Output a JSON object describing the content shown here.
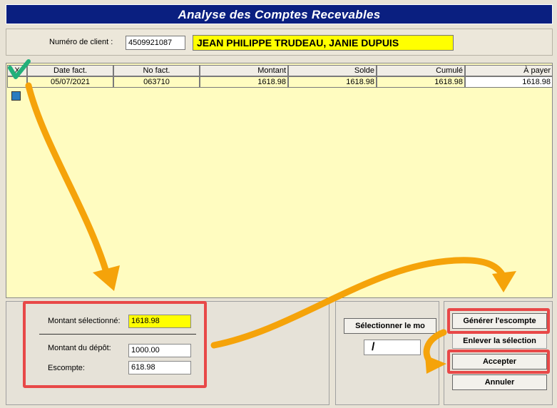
{
  "window": {
    "title": "Analyse des Comptes Recevables"
  },
  "client": {
    "label": "Numéro de client :",
    "number": "4509921087",
    "name": "JEAN PHILIPPE TRUDEAU, JANIE DUPUIS"
  },
  "grid": {
    "columns": [
      "X",
      "Date fact.",
      "No fact.",
      "Montant",
      "Solde",
      "Cumulé",
      "À payer"
    ],
    "rows": [
      {
        "checked": true,
        "date": "05/07/2021",
        "invoice": "063710",
        "montant": "1618.98",
        "solde": "1618.98",
        "cumule": "1618.98",
        "a_payer": "1618.98"
      }
    ]
  },
  "summary": {
    "montant_selectionne_label": "Montant sélectionné:",
    "montant_selectionne_value": "1618.98",
    "montant_depot_label": "Montant du dépôt:",
    "montant_depot_value": "1000.00",
    "escompte_label": "Escompte:",
    "escompte_value": "618.98"
  },
  "middle": {
    "select_button_label": "Sélectionner le mo",
    "small_field_value": "/"
  },
  "actions": {
    "generer": "Générer l'escompte",
    "enlever": "Enlever la sélection",
    "accepter": "Accepter",
    "annuler": "Annuler"
  },
  "colors": {
    "title_bg": "#0a1f80",
    "grid_bg": "#fffcc0",
    "highlight_yellow": "#ffff00",
    "annotation_orange": "#f5a30a",
    "annotation_red": "#e84848",
    "annotation_check": "#22b07a"
  }
}
